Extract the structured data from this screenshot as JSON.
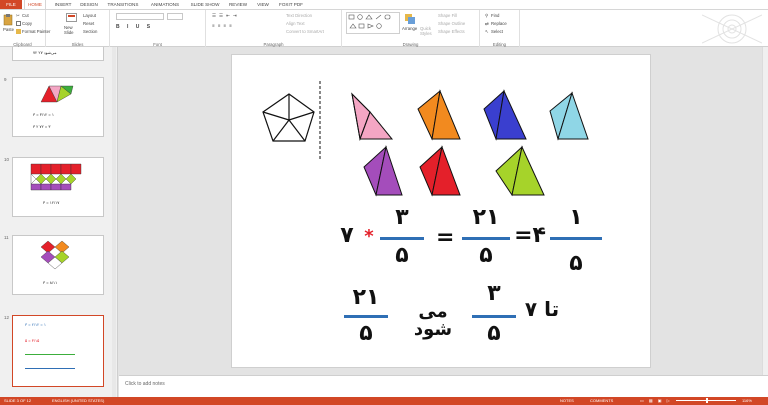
{
  "tabs": {
    "file": "FILE",
    "home": "HOME",
    "insert": "INSERT",
    "design": "DESIGN",
    "transitions": "TRANSITIONS",
    "animations": "ANIMATIONS",
    "slideshow": "SLIDE SHOW",
    "review": "REVIEW",
    "view": "VIEW",
    "foxit": "FOXIT PDF"
  },
  "ribbon": {
    "clipboard": {
      "label": "Clipboard",
      "paste": "Paste",
      "cut": "Cut",
      "copy": "Copy",
      "format_painter": "Format Painter"
    },
    "slides": {
      "label": "Slides",
      "new_slide": "New Slide",
      "layout": "Layout",
      "reset": "Reset",
      "section": "Section"
    },
    "font": {
      "label": "Font"
    },
    "paragraph": {
      "label": "Paragraph",
      "text_direction": "Text Direction",
      "align_text": "Align Text",
      "smartart": "Convert to SmartArt"
    },
    "drawing": {
      "label": "Drawing",
      "arrange": "Arrange",
      "quick_styles": "Quick Styles",
      "shape_fill": "Shape Fill",
      "shape_outline": "Shape Outline",
      "shape_effects": "Shape Effects"
    },
    "editing": {
      "label": "Editing",
      "find": "Find",
      "replace": "Replace",
      "select": "Select"
    }
  },
  "thumbnails": [
    {
      "num": "9",
      "line1": "۳ = ۳/۱۲ = ۱",
      "line2": "۳ ۲ ۷۲ = ۳"
    },
    {
      "num": "10",
      "line1": "۴ = ۱۲/۱۷",
      "line2": ""
    },
    {
      "num": "11",
      "line1": "۳ = ۸/۱۱",
      "line2": ""
    },
    {
      "num": "12",
      "line1": "۳ = ۲/۱۲ = ۱",
      "line2": "۵ = ۳/۱۵"
    }
  ],
  "thumb_top": {
    "line": "۷۲ می‌شود ۲۷"
  },
  "slide": {
    "whole": "۷",
    "times": "*",
    "num1": "۳",
    "den1": "۵",
    "eq1": "=",
    "num2": "۲۱",
    "den2": "۵",
    "eq2": "=۴",
    "num3": "۱",
    "den3": "۵",
    "r2_num_a": "۲۱",
    "r2_den_a": "۵",
    "r2_text": "می شود",
    "r2_num_b": "۳",
    "r2_den_b": "۵",
    "r2_prefix": "۷ تا"
  },
  "colors": {
    "pink": "#f4a6c4",
    "orange": "#f28a1f",
    "blue": "#3a3fcf",
    "lightblue": "#8fd6e6",
    "purple": "#a44dbb",
    "red": "#e4202a",
    "lime": "#a6d32a",
    "accent": "#d24726",
    "bar": "#2f6fb5"
  },
  "notes": "Click to add notes",
  "status": {
    "slide": "SLIDE 3 OF 12",
    "lang": "ENGLISH (UNITED STATES)",
    "notes": "NOTES",
    "comments": "COMMENTS",
    "zoom": "116%"
  }
}
